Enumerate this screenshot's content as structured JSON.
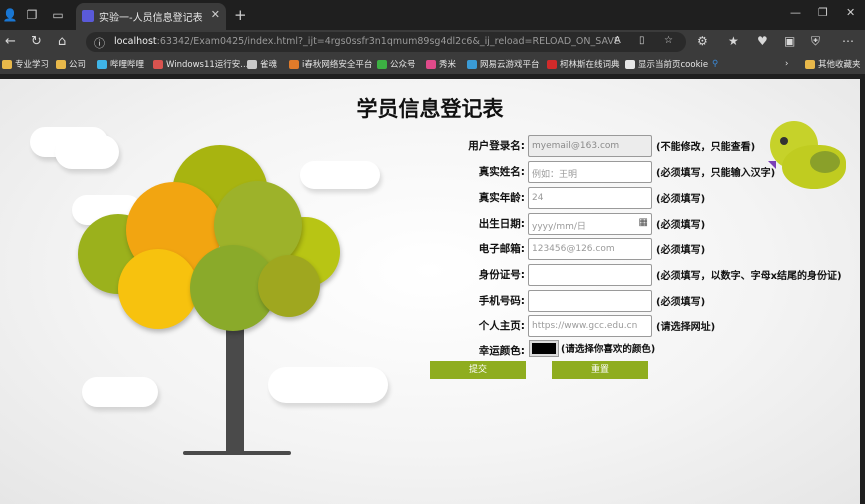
{
  "browser": {
    "tab_title": "实验一-人员信息登记表",
    "url_host": "localhost",
    "url_rest": ":63342/Exam0425/index.html?_ijt=4rgs0ssfr3n1qmum89sg4dl2c6&_ij_reload=RELOAD_ON_SAVE",
    "bookmarks": [
      "专业学习",
      "公司",
      "哔哩哔哩",
      "Windows11运行安...",
      "雀魂",
      "i春秋网络安全平台",
      "公众号",
      "秀米",
      "网易云游戏平台",
      "柯林斯在线词典",
      "显示当前页cookie",
      "其他收藏夹"
    ]
  },
  "page": {
    "title": "学员信息登记表"
  },
  "form": {
    "fields": [
      {
        "label": "用户登录名:",
        "value": "myemail@163.com",
        "note": "(不能修改，只能查看)"
      },
      {
        "label": "真实姓名:",
        "value": "例如：王明",
        "note": "(必须填写，只能输入汉字)"
      },
      {
        "label": "真实年龄:",
        "value": "24",
        "note": "(必须填写)"
      },
      {
        "label": "出生日期:",
        "value": "yyyy/mm/日",
        "note": "(必须填写)"
      },
      {
        "label": "电子邮箱:",
        "value": "123456@126.com",
        "note": "(必须填写)"
      },
      {
        "label": "身份证号:",
        "value": "",
        "note": "(必须填写，以数字、字母x结尾的身份证)"
      },
      {
        "label": "手机号码:",
        "value": "",
        "note": "(必须填写)"
      },
      {
        "label": "个人主页:",
        "value": "https://www.gcc.edu.cn",
        "note": "(请选择网址)"
      },
      {
        "label": "幸运颜色:",
        "value": "",
        "note": "(请选择你喜欢的颜色)"
      }
    ],
    "submit_label": "提交",
    "reset_label": "重置",
    "lucky_color": "#000000"
  }
}
